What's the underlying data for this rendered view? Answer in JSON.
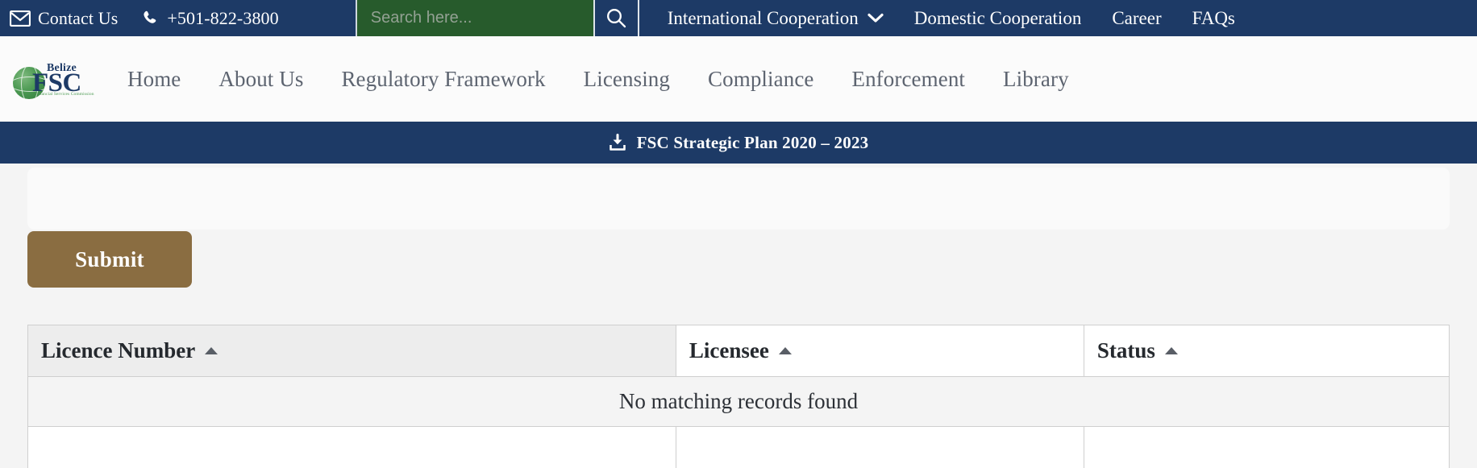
{
  "topbar": {
    "contact": {
      "icon": "envelope-icon",
      "label": "Contact Us"
    },
    "phone": {
      "icon": "phone-icon",
      "label": "+501-822-3800"
    },
    "search": {
      "placeholder": "Search here...",
      "value": "",
      "icon": "search-icon"
    },
    "nav": [
      {
        "label": "International Cooperation",
        "has_dropdown": true,
        "icon": "chevron-down-icon"
      },
      {
        "label": "Domestic Cooperation",
        "has_dropdown": false
      },
      {
        "label": "Career",
        "has_dropdown": false
      },
      {
        "label": "FAQs",
        "has_dropdown": false
      }
    ]
  },
  "brand": {
    "top_word": "Belize",
    "acronym": "FSC",
    "tagline": "Financial Services Commission"
  },
  "mainnav": {
    "items": [
      {
        "label": "Home"
      },
      {
        "label": "About Us"
      },
      {
        "label": "Regulatory Framework"
      },
      {
        "label": "Licensing"
      },
      {
        "label": "Compliance"
      },
      {
        "label": "Enforcement"
      },
      {
        "label": "Library"
      }
    ]
  },
  "plan_banner": {
    "icon": "download-icon",
    "label": "FSC Strategic Plan 2020 – 2023"
  },
  "form": {
    "submit_label": "Submit"
  },
  "table": {
    "columns": [
      {
        "label": "Licence Number",
        "sort": "asc",
        "sort_icon": "caret-up-icon"
      },
      {
        "label": "Licensee",
        "sort": "asc",
        "sort_icon": "caret-up-icon"
      },
      {
        "label": "Status",
        "sort": "asc",
        "sort_icon": "caret-up-icon"
      }
    ],
    "empty_message": "No matching records found",
    "rows": []
  },
  "colors": {
    "navy": "#1d3a66",
    "green": "#275b2c",
    "brown": "#8a6d41",
    "page_bg": "#f4f4f4",
    "nav_text": "#5d6470"
  }
}
